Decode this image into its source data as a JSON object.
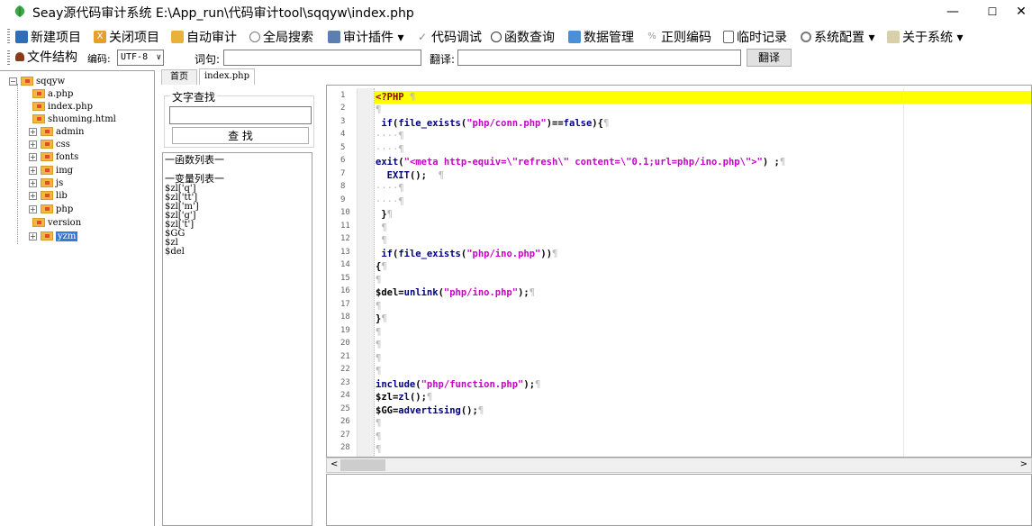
{
  "window": {
    "title": "Seay源代码审计系统  E:\\App_run\\代码审计tool\\sqqyw\\index.php",
    "min_glyph": "—",
    "max_glyph": "☐",
    "close_glyph": "✕"
  },
  "menu": [
    {
      "label": "新建项目",
      "icon": "new-project-icon"
    },
    {
      "label": "关闭项目",
      "icon": "close-project-icon"
    },
    {
      "label": "自动审计",
      "icon": "auto-audit-icon"
    },
    {
      "label": "全局搜索",
      "icon": "global-search-icon"
    },
    {
      "label": "审计插件 ▾",
      "icon": "plugin-icon"
    },
    {
      "label": "代码调试",
      "icon": "debug-icon"
    },
    {
      "label": "函数查询",
      "icon": "function-query-icon"
    },
    {
      "label": "数据管理",
      "icon": "data-manage-icon"
    },
    {
      "label": "正则编码",
      "icon": "regex-icon"
    },
    {
      "label": "临时记录",
      "icon": "notes-icon"
    },
    {
      "label": "系统配置 ▾",
      "icon": "settings-icon"
    },
    {
      "label": "关于系统 ▾",
      "icon": "about-icon"
    }
  ],
  "toolbar2": {
    "filestruct_label": "文件结构",
    "encoding_label": "编码:",
    "encoding_value": "UTF-8",
    "word_label": "词句:",
    "word_value": "",
    "translate_label": "翻译:",
    "translate_value": "",
    "translate_button": "翻译"
  },
  "tree": {
    "root": "sqqyw",
    "items": [
      "a.php",
      "index.php",
      "shuoming.html",
      "admin",
      "css",
      "fonts",
      "img",
      "js",
      "lib",
      "php",
      "version",
      "yzm"
    ]
  },
  "search_panel": {
    "legend": "文字查找",
    "query_value": "",
    "button": "查 找"
  },
  "func_panel": {
    "func_header": "一函数列表一",
    "var_header": "一变量列表一",
    "vars": [
      "$zl['q']",
      "$zl['tt']",
      "$zl['m']",
      "$zl['g']",
      "$zl['t']",
      "$GG",
      "$zl",
      "$del"
    ]
  },
  "tabs": [
    "首页",
    "index.php"
  ],
  "editor": {
    "line_numbers": [
      "1",
      "2",
      "3",
      "4",
      "5",
      "6",
      "7",
      "8",
      "9",
      "10",
      "11",
      "12",
      "13",
      "14",
      "15",
      "16",
      "17",
      "18",
      "19",
      "20",
      "21",
      "22",
      "23",
      "24",
      "25",
      "26",
      "27",
      "28"
    ],
    "pilcrow": "¶"
  }
}
